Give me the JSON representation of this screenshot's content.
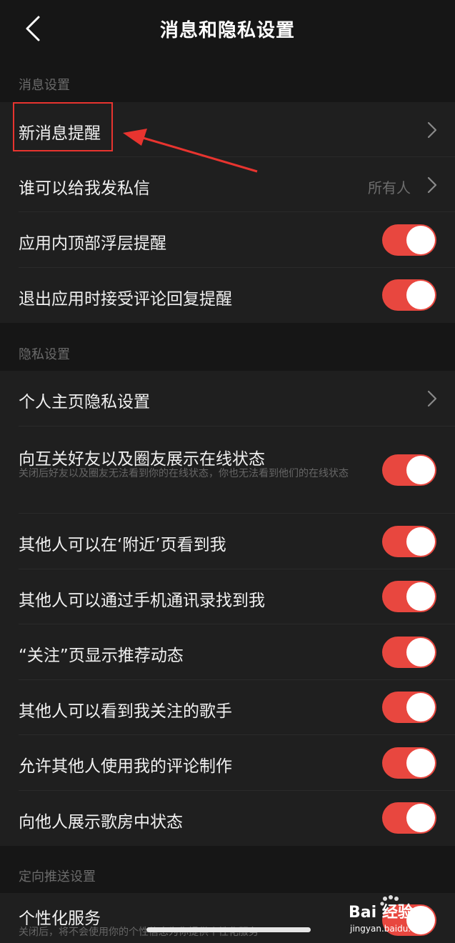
{
  "header": {
    "title": "消息和隐私设置",
    "back_icon": "chevron-left-icon"
  },
  "sections": {
    "message": {
      "title": "消息设置",
      "new_message_alert": "新消息提醒",
      "who_can_dm": "谁可以给我发私信",
      "who_can_dm_value": "所有人",
      "in_app_top_banner": "应用内顶部浮层提醒",
      "exit_app_comment_reply": "退出应用时接受评论回复提醒"
    },
    "privacy": {
      "title": "隐私设置",
      "profile_privacy": "个人主页隐私设置",
      "online_status": "向互关好友以及圈友展示在线状态",
      "online_status_desc": "关闭后好友以及圈友无法看到你的在线状态，你也无法看到他们的在线状态",
      "nearby_visible": "其他人可以在‘附近’页看到我",
      "find_by_contacts": "其他人可以通过手机通讯录找到我",
      "follow_recommend": "“关注”页显示推荐动态",
      "see_followed_singers": "其他人可以看到我关注的歌手",
      "comment_creation": "允许其他人使用我的评论制作",
      "karaoke_room_status": "向他人展示歌房中状态"
    },
    "targeted": {
      "title": "定向推送设置",
      "personalized_service": "个性化服务",
      "personalized_service_desc": "关闭后，将不会使用你的个性信息为你提供个性化服务"
    }
  },
  "toggles": {
    "in_app_top_banner": true,
    "exit_app_comment_reply": true,
    "online_status": true,
    "nearby_visible": true,
    "find_by_contacts": true,
    "follow_recommend": true,
    "see_followed_singers": true,
    "comment_creation": true,
    "karaoke_room_status": true,
    "personalized_service": true
  },
  "watermark": {
    "brand": "Bai 经验",
    "site": "jingyan.baidu.com"
  },
  "colors": {
    "accent": "#e8473f",
    "background": "#161616",
    "row": "#1f1f1f",
    "annotation": "#e8342f"
  }
}
